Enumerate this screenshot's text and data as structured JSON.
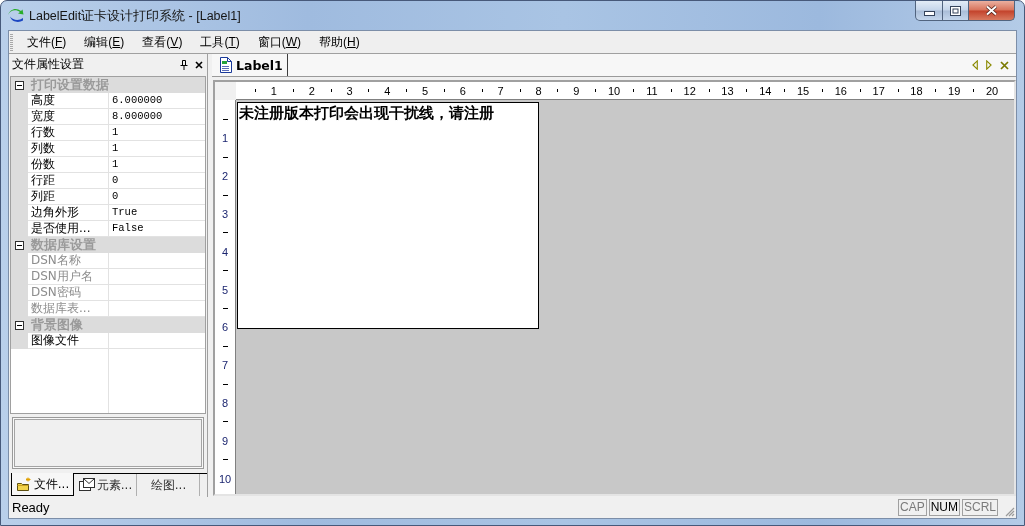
{
  "window": {
    "title": "LabelEdit证卡设计打印系统 - [Label1]"
  },
  "menu_bar": [
    {
      "before": "文件(",
      "access_key": "F",
      "after": ")"
    },
    {
      "before": "编辑(",
      "access_key": "E",
      "after": ")"
    },
    {
      "before": "查看(",
      "access_key": "V",
      "after": ")"
    },
    {
      "before": "工具(",
      "access_key": "T",
      "after": ")"
    },
    {
      "before": "窗口(",
      "access_key": "W",
      "after": ")"
    },
    {
      "before": "帮助(",
      "access_key": "H",
      "after": ")"
    }
  ],
  "property_panel": {
    "title": "文件属性设置",
    "categories": [
      {
        "name": "打印设置数据",
        "expanded": true,
        "properties": [
          {
            "name": "高度",
            "value": "6.000000",
            "disabled": false
          },
          {
            "name": "宽度",
            "value": "8.000000",
            "disabled": false
          },
          {
            "name": "行数",
            "value": "1",
            "disabled": false
          },
          {
            "name": "列数",
            "value": "1",
            "disabled": false
          },
          {
            "name": "份数",
            "value": "1",
            "disabled": false
          },
          {
            "name": "行距",
            "value": "0",
            "disabled": false
          },
          {
            "name": "列距",
            "value": "0",
            "disabled": false
          },
          {
            "name": "边角外形",
            "value": "True",
            "disabled": false
          },
          {
            "name": "是否使用...",
            "value": "False",
            "disabled": false
          }
        ]
      },
      {
        "name": "数据库设置",
        "expanded": true,
        "properties": [
          {
            "name": "DSN名称",
            "disabled": true
          },
          {
            "name": "DSN用户名",
            "disabled": true
          },
          {
            "name": "DSN密码",
            "disabled": true
          },
          {
            "name": "数据库表...",
            "disabled": true
          }
        ]
      },
      {
        "name": "背景图像",
        "expanded": true,
        "properties": [
          {
            "name": "图像文件",
            "disabled": false
          }
        ]
      }
    ],
    "tabs": [
      {
        "label": "文件...",
        "kind": "file",
        "selected": true
      },
      {
        "label": "元素...",
        "kind": "element",
        "selected": false
      },
      {
        "label": "绘图...",
        "kind": "drawing",
        "selected": false
      }
    ]
  },
  "document_tabs": [
    {
      "label": "Label1",
      "selected": true
    }
  ],
  "rulers": {
    "horizontal": [
      "1",
      "2",
      "3",
      "4",
      "5",
      "6",
      "7",
      "8",
      "9",
      "10",
      "11",
      "12",
      "13",
      "14",
      "15",
      "16",
      "17",
      "18",
      "19",
      "20"
    ],
    "vertical": [
      "1",
      "2",
      "3",
      "4",
      "5",
      "6",
      "7",
      "8",
      "9",
      "10"
    ]
  },
  "page": {
    "notice": "未注册版本打印会出现干扰线，请注册"
  },
  "status_bar": {
    "text": "Ready",
    "indicators": [
      {
        "label": "CAP",
        "on": false
      },
      {
        "label": "NUM",
        "on": true
      },
      {
        "label": "SCRL",
        "on": false
      }
    ]
  }
}
